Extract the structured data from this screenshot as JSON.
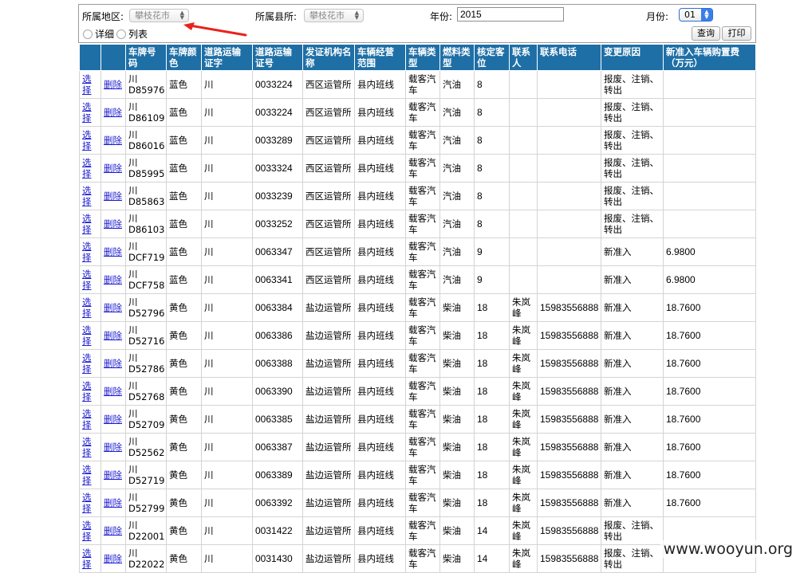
{
  "filters": {
    "region_label": "所属地区:",
    "region_value": "攀枝花市",
    "county_label": "所属县所:",
    "county_value": "攀枝花市",
    "year_label": "年份:",
    "year_value": "2015",
    "month_label": "月份:",
    "month_value": "01",
    "radio_detail": "详细",
    "radio_list": "列表",
    "query_button": "查询",
    "print_button": "打印"
  },
  "table": {
    "headers": [
      "",
      "",
      "车牌号码",
      "车牌颜色",
      "道路运输证字",
      "道路运输证号",
      "发证机构名称",
      "车辆经营范围",
      "车辆类型",
      "燃料类型",
      "核定客位",
      "联系人",
      "联系电话",
      "变更原因",
      "新准入车辆购置费（万元）"
    ],
    "select_label": "选择",
    "delete_label": "删除",
    "rows": [
      {
        "plate": "川D85976",
        "color": "蓝色",
        "cert_word": "川",
        "cert_no": "0033224",
        "issuer": "西区运管所",
        "scope": "县内班线",
        "vtype": "载客汽车",
        "fuel": "汽油",
        "seats": "8",
        "contact": "",
        "phone": "",
        "reason": "报废、注销、转出",
        "cost": ""
      },
      {
        "plate": "川D86109",
        "color": "蓝色",
        "cert_word": "川",
        "cert_no": "0033224",
        "issuer": "西区运管所",
        "scope": "县内班线",
        "vtype": "载客汽车",
        "fuel": "汽油",
        "seats": "8",
        "contact": "",
        "phone": "",
        "reason": "报废、注销、转出",
        "cost": ""
      },
      {
        "plate": "川D86016",
        "color": "蓝色",
        "cert_word": "川",
        "cert_no": "0033289",
        "issuer": "西区运管所",
        "scope": "县内班线",
        "vtype": "载客汽车",
        "fuel": "汽油",
        "seats": "8",
        "contact": "",
        "phone": "",
        "reason": "报废、注销、转出",
        "cost": ""
      },
      {
        "plate": "川D85995",
        "color": "蓝色",
        "cert_word": "川",
        "cert_no": "0033324",
        "issuer": "西区运管所",
        "scope": "县内班线",
        "vtype": "载客汽车",
        "fuel": "汽油",
        "seats": "8",
        "contact": "",
        "phone": "",
        "reason": "报废、注销、转出",
        "cost": ""
      },
      {
        "plate": "川D85863",
        "color": "蓝色",
        "cert_word": "川",
        "cert_no": "0033239",
        "issuer": "西区运管所",
        "scope": "县内班线",
        "vtype": "载客汽车",
        "fuel": "汽油",
        "seats": "8",
        "contact": "",
        "phone": "",
        "reason": "报废、注销、转出",
        "cost": ""
      },
      {
        "plate": "川D86103",
        "color": "蓝色",
        "cert_word": "川",
        "cert_no": "0033252",
        "issuer": "西区运管所",
        "scope": "县内班线",
        "vtype": "载客汽车",
        "fuel": "汽油",
        "seats": "8",
        "contact": "",
        "phone": "",
        "reason": "报废、注销、转出",
        "cost": ""
      },
      {
        "plate": "川DCF719",
        "color": "蓝色",
        "cert_word": "川",
        "cert_no": "0063347",
        "issuer": "西区运管所",
        "scope": "县内班线",
        "vtype": "载客汽车",
        "fuel": "汽油",
        "seats": "9",
        "contact": "",
        "phone": "",
        "reason": "新准入",
        "cost": "6.9800"
      },
      {
        "plate": "川DCF758",
        "color": "蓝色",
        "cert_word": "川",
        "cert_no": "0063341",
        "issuer": "西区运管所",
        "scope": "县内班线",
        "vtype": "载客汽车",
        "fuel": "汽油",
        "seats": "9",
        "contact": "",
        "phone": "",
        "reason": "新准入",
        "cost": "6.9800"
      },
      {
        "plate": "川D52796",
        "color": "黄色",
        "cert_word": "川",
        "cert_no": "0063384",
        "issuer": "盐边运管所",
        "scope": "县内班线",
        "vtype": "载客汽车",
        "fuel": "柴油",
        "seats": "18",
        "contact": "朱岚峰",
        "phone": "15983556888",
        "reason": "新准入",
        "cost": "18.7600"
      },
      {
        "plate": "川D52716",
        "color": "黄色",
        "cert_word": "川",
        "cert_no": "0063386",
        "issuer": "盐边运管所",
        "scope": "县内班线",
        "vtype": "载客汽车",
        "fuel": "柴油",
        "seats": "18",
        "contact": "朱岚峰",
        "phone": "15983556888",
        "reason": "新准入",
        "cost": "18.7600"
      },
      {
        "plate": "川D52786",
        "color": "黄色",
        "cert_word": "川",
        "cert_no": "0063388",
        "issuer": "盐边运管所",
        "scope": "县内班线",
        "vtype": "载客汽车",
        "fuel": "柴油",
        "seats": "18",
        "contact": "朱岚峰",
        "phone": "15983556888",
        "reason": "新准入",
        "cost": "18.7600"
      },
      {
        "plate": "川D52768",
        "color": "黄色",
        "cert_word": "川",
        "cert_no": "0063390",
        "issuer": "盐边运管所",
        "scope": "县内班线",
        "vtype": "载客汽车",
        "fuel": "柴油",
        "seats": "18",
        "contact": "朱岚峰",
        "phone": "15983556888",
        "reason": "新准入",
        "cost": "18.7600"
      },
      {
        "plate": "川D52709",
        "color": "黄色",
        "cert_word": "川",
        "cert_no": "0063385",
        "issuer": "盐边运管所",
        "scope": "县内班线",
        "vtype": "载客汽车",
        "fuel": "柴油",
        "seats": "18",
        "contact": "朱岚峰",
        "phone": "15983556888",
        "reason": "新准入",
        "cost": "18.7600"
      },
      {
        "plate": "川D52562",
        "color": "黄色",
        "cert_word": "川",
        "cert_no": "0063387",
        "issuer": "盐边运管所",
        "scope": "县内班线",
        "vtype": "载客汽车",
        "fuel": "柴油",
        "seats": "18",
        "contact": "朱岚峰",
        "phone": "15983556888",
        "reason": "新准入",
        "cost": "18.7600"
      },
      {
        "plate": "川D52719",
        "color": "黄色",
        "cert_word": "川",
        "cert_no": "0063389",
        "issuer": "盐边运管所",
        "scope": "县内班线",
        "vtype": "载客汽车",
        "fuel": "柴油",
        "seats": "18",
        "contact": "朱岚峰",
        "phone": "15983556888",
        "reason": "新准入",
        "cost": "18.7600"
      },
      {
        "plate": "川D52799",
        "color": "黄色",
        "cert_word": "川",
        "cert_no": "0063392",
        "issuer": "盐边运管所",
        "scope": "县内班线",
        "vtype": "载客汽车",
        "fuel": "柴油",
        "seats": "18",
        "contact": "朱岚峰",
        "phone": "15983556888",
        "reason": "新准入",
        "cost": "18.7600"
      },
      {
        "plate": "川D22001",
        "color": "黄色",
        "cert_word": "川",
        "cert_no": "0031422",
        "issuer": "盐边运管所",
        "scope": "县内班线",
        "vtype": "载客汽车",
        "fuel": "柴油",
        "seats": "14",
        "contact": "朱岚峰",
        "phone": "15983556888",
        "reason": "报废、注销、转出",
        "cost": ""
      },
      {
        "plate": "川D22022",
        "color": "黄色",
        "cert_word": "川",
        "cert_no": "0031430",
        "issuer": "盐边运管所",
        "scope": "县内班线",
        "vtype": "载客汽车",
        "fuel": "柴油",
        "seats": "14",
        "contact": "朱岚峰",
        "phone": "15983556888",
        "reason": "报废、注销、转出",
        "cost": ""
      }
    ]
  },
  "watermark": "www.wooyun.org",
  "colors": {
    "header_bg": "#1e6fa6",
    "link": "#1c1cd0",
    "annotation_arrow": "#e8231a"
  }
}
